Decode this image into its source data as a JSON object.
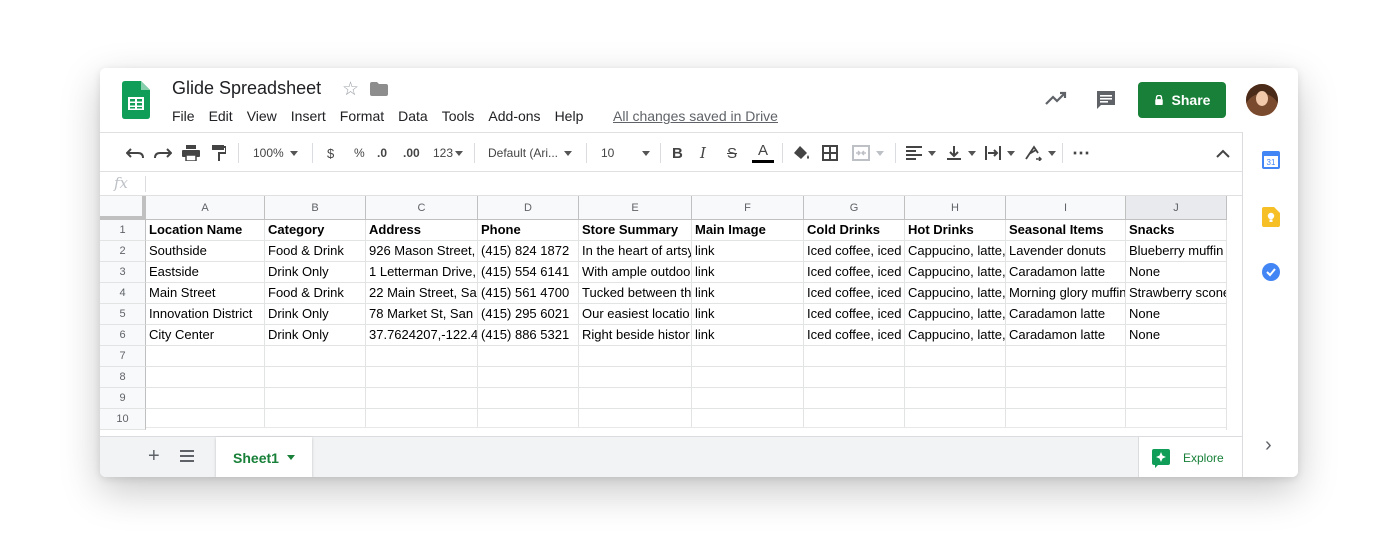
{
  "header": {
    "title": "Glide Spreadsheet",
    "menu": [
      "File",
      "Edit",
      "View",
      "Insert",
      "Format",
      "Data",
      "Tools",
      "Add-ons",
      "Help"
    ],
    "saved_status": "All changes saved in Drive",
    "share_label": "Share"
  },
  "toolbar": {
    "zoom": "100%",
    "currency": "$",
    "percent": "%",
    "dec_decrease": ".0",
    "dec_increase": ".00",
    "number_format": "123",
    "font": "Default (Ari...",
    "font_size": "10",
    "bold": "B",
    "italic": "I",
    "strike": "S",
    "text_color_glyph": "A",
    "more": "⋯"
  },
  "formula_bar": {
    "fx": "fx"
  },
  "grid": {
    "columns": [
      "A",
      "B",
      "C",
      "D",
      "E",
      "F",
      "G",
      "H",
      "I",
      "J"
    ],
    "row_numbers": [
      "1",
      "2",
      "3",
      "4",
      "5",
      "6",
      "7",
      "8",
      "9",
      "10"
    ],
    "rows": [
      [
        "Location Name",
        "Category",
        "Address",
        "Phone",
        "Store Summary",
        "Main Image",
        "Cold Drinks",
        "Hot Drinks",
        "Seasonal Items",
        "Snacks"
      ],
      [
        "Southside",
        "Food & Drink",
        "926 Mason Street,",
        "(415) 824 1872",
        "In the heart of artsy",
        "link",
        "Iced coffee, iced",
        "Cappucino, latte,",
        "Lavender donuts",
        "Blueberry muffin"
      ],
      [
        "Eastside",
        "Drink Only",
        "1 Letterman Drive,",
        "(415) 554 6141",
        "With ample outdoo",
        "link",
        "Iced coffee, iced",
        "Cappucino, latte,",
        "Caradamon latte",
        "None"
      ],
      [
        "Main Street",
        "Food & Drink",
        "22 Main Street, Sa",
        "(415) 561 4700",
        "Tucked between th",
        "link",
        "Iced coffee, iced",
        "Cappucino, latte,",
        "Morning glory muffin",
        "Strawberry scone"
      ],
      [
        "Innovation District",
        "Drink Only",
        "78 Market St, San",
        "(415) 295 6021",
        "Our easiest locatio",
        "link",
        "Iced coffee, iced",
        "Cappucino, latte,",
        "Caradamon latte",
        "None"
      ],
      [
        "City Center",
        "Drink Only",
        "37.7624207,-122.4",
        "(415) 886 5321",
        "Right beside histor",
        "link",
        "Iced coffee, iced",
        "Cappucino, latte,",
        "Caradamon latte",
        "None"
      ],
      [
        "",
        "",
        "",
        "",
        "",
        "",
        "",
        "",
        "",
        ""
      ],
      [
        "",
        "",
        "",
        "",
        "",
        "",
        "",
        "",
        "",
        ""
      ],
      [
        "",
        "",
        "",
        "",
        "",
        "",
        "",
        "",
        "",
        ""
      ],
      [
        "",
        "",
        "",
        "",
        "",
        "",
        "",
        "",
        "",
        ""
      ]
    ]
  },
  "sheets": {
    "active": "Sheet1",
    "add": "+"
  },
  "explore_label": "Explore",
  "side_panel": {
    "collapse": "›"
  },
  "colors": {
    "accent": "#188038",
    "header_bg": "#f8f9fa",
    "grid_line": "#e2e3e3"
  }
}
